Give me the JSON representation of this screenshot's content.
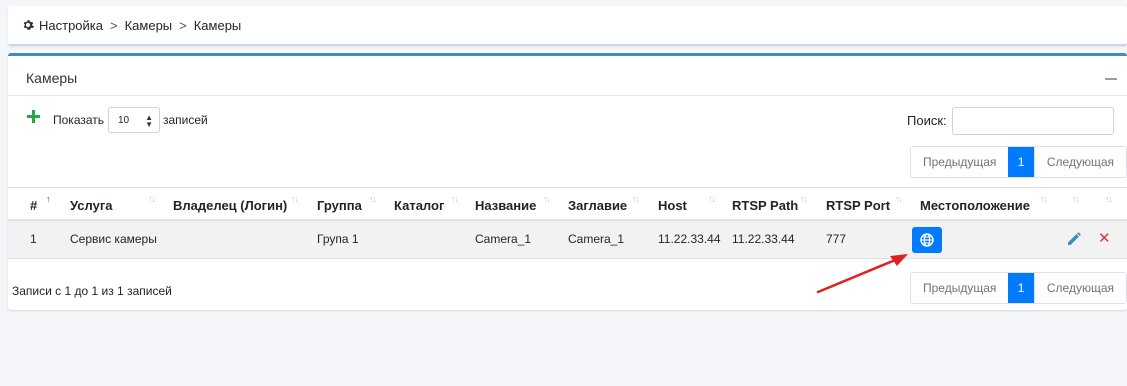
{
  "breadcrumb": {
    "items": [
      "Настройка",
      "Камеры",
      "Камеры"
    ],
    "separator": ">"
  },
  "card": {
    "title": "Камеры"
  },
  "controls": {
    "show_label": "Показать",
    "page_length": "10",
    "records_label": "записей",
    "search_label": "Поиск:",
    "search_value": ""
  },
  "pager": {
    "prev": "Предыдущая",
    "current": "1",
    "next": "Следующая"
  },
  "table": {
    "headers": [
      "#",
      "Услуга",
      "Владелец (Логин)",
      "Группа",
      "Каталог",
      "Название",
      "Заглавие",
      "Host",
      "RTSP Path",
      "RTSP Port",
      "Местоположение"
    ],
    "rows": [
      [
        "1",
        "Сервис камеры",
        "",
        "Група 1",
        "",
        "Camera_1",
        "Camera_1",
        "11.22.33.44",
        "11.22.33.44",
        "777",
        ""
      ]
    ]
  },
  "info": "Записи с 1 до 1 из 1 записей",
  "colors": {
    "primary": "#007bff",
    "add": "#28a745",
    "delete": "#dc3545",
    "arrow": "#e02020"
  },
  "icons": {
    "breadcrumb": "gear-icon",
    "location": "globe-icon",
    "edit": "pencil-icon",
    "delete": "times-icon",
    "add": "plus-icon"
  }
}
